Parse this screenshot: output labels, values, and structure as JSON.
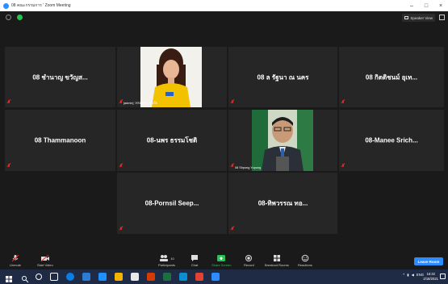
{
  "window": {
    "title": "08 คณะกรรมการ ' Zoom Meeting",
    "controls": [
      "–",
      "□",
      "×"
    ]
  },
  "topbar": {
    "speaker_view_label": "Speaker View"
  },
  "tiles": [
    {
      "name": "08 ชำนาญ ขวัญส..."
    },
    {
      "name": "08 ล รัฐนา ณ นคร"
    },
    {
      "name": "08 กิตติชนม์ อุเท..."
    },
    {
      "name": "08 Thammanoon"
    },
    {
      "name": "08-นพร ธรรมโชติ"
    },
    {
      "name": "08-Manee Srich..."
    },
    {
      "name": "08-Pornsil Seep..."
    },
    {
      "name": "08-ทิพวรรณ ทอ..."
    }
  ],
  "video_captions": {
    "woman": "[admin] วรรณชิดา ดวงใจ",
    "man": "08 Sirpong Yupong"
  },
  "toolbar": {
    "unmute": "Unmute",
    "start_video": "Start Video",
    "participants": "Participants",
    "participants_count": "10",
    "chat": "Chat",
    "share_screen": "Share Screen",
    "record": "Record",
    "breakout_rooms": "Breakout Rooms",
    "reactions": "Reactions",
    "leave_room": "Leave Room"
  },
  "taskbar": {
    "time": "16:32",
    "date": "2/18/2021",
    "lang": "ENG"
  },
  "colors": {
    "zoom_blue": "#2d8cff",
    "tile_bg": "#262626",
    "meeting_bg": "#1a1a1a",
    "muted_red": "#e02828",
    "share_green": "#23c552"
  }
}
